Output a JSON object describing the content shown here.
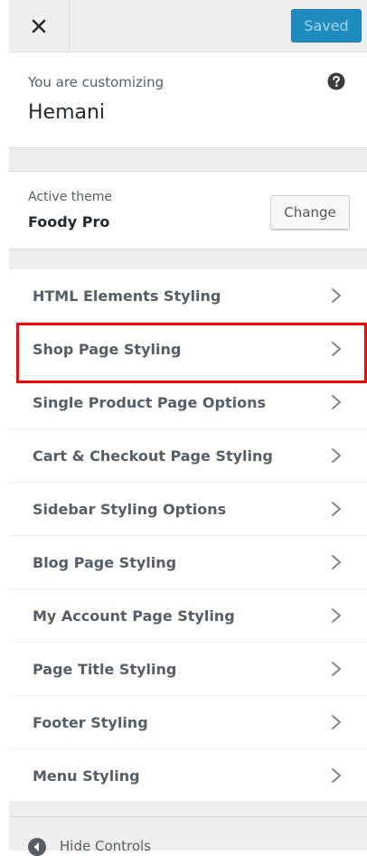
{
  "header": {
    "close_icon": "close-icon",
    "save_label": "Saved",
    "save_color": "#1e8cbe"
  },
  "info": {
    "label": "You are customizing",
    "site_name": "Hemani",
    "help_icon": "help-icon"
  },
  "theme": {
    "label": "Active theme",
    "name": "Foody Pro",
    "change_label": "Change"
  },
  "menu": {
    "items": [
      {
        "label": "HTML Elements Styling"
      },
      {
        "label": "Shop Page Styling"
      },
      {
        "label": "Single Product Page Options"
      },
      {
        "label": "Cart & Checkout Page Styling"
      },
      {
        "label": "Sidebar Styling Options"
      },
      {
        "label": "Blog Page Styling"
      },
      {
        "label": "My Account Page Styling"
      },
      {
        "label": "Page Title Styling"
      },
      {
        "label": "Footer Styling"
      },
      {
        "label": "Menu Styling"
      }
    ],
    "highlight_color": "#ff0000"
  },
  "footer": {
    "hide_label": "Hide Controls",
    "hide_icon": "collapse-arrow-icon"
  }
}
